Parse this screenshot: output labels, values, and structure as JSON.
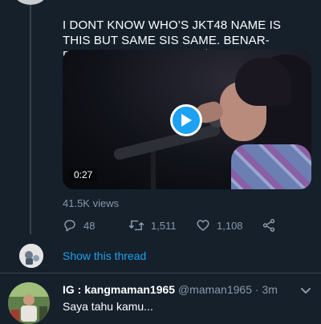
{
  "tweet": {
    "text": "I DONT KNOW WHO’S JKT48 NAME IS THIS BUT SAME SIS SAME. BENAR-BENAR SPIRIT ANIMAL👏",
    "video_duration": "0:27",
    "views": "41.5K views",
    "actions": {
      "replies": "48",
      "retweets": "1,511",
      "likes": "1,108"
    },
    "show_thread_label": "Show this thread"
  },
  "reply": {
    "display_name": "IG : kangmaman1965",
    "handle": "@maman1965",
    "separator": "·",
    "time": "3m",
    "text": "Saya tahu kamu..."
  },
  "icons": {
    "reply": "reply-icon",
    "retweet": "retweet-icon",
    "like": "heart-icon",
    "share": "share-icon",
    "play": "play-icon",
    "more": "chevron-down-icon"
  },
  "colors": {
    "background": "#15202b",
    "accent": "#1da1f2",
    "muted": "#8899a6",
    "divider": "#38444d"
  }
}
